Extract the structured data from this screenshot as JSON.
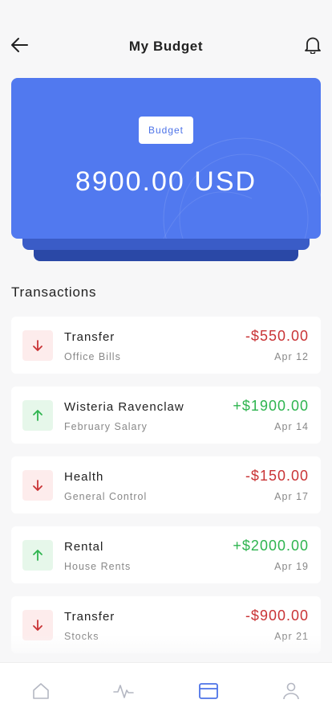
{
  "header": {
    "title": "My Budget",
    "back_icon": "arrow-left-icon",
    "notification_icon": "bell-icon"
  },
  "card": {
    "badge": "Budget",
    "amount": "8900.00 USD",
    "color": "#5179ef"
  },
  "transactions_title": "Transactions",
  "transactions": [
    {
      "name": "Transfer",
      "sub": "Office Bills",
      "amount": "-$550.00",
      "date": "Apr 12",
      "direction": "down"
    },
    {
      "name": "Wisteria Ravenclaw",
      "sub": "February Salary",
      "amount": "+$1900.00",
      "date": "Apr 14",
      "direction": "up"
    },
    {
      "name": "Health",
      "sub": "General Control",
      "amount": "-$150.00",
      "date": "Apr 17",
      "direction": "down"
    },
    {
      "name": "Rental",
      "sub": "House Rents",
      "amount": "+$2000.00",
      "date": "Apr 19",
      "direction": "up"
    },
    {
      "name": "Transfer",
      "sub": "Stocks",
      "amount": "-$900.00",
      "date": "Apr 21",
      "direction": "down"
    }
  ],
  "colors": {
    "negative": "#c93335",
    "positive": "#2eb44f",
    "active_tab": "#4d73e8"
  },
  "tabbar": {
    "items": [
      {
        "icon": "home-icon",
        "active": false
      },
      {
        "icon": "activity-icon",
        "active": false
      },
      {
        "icon": "card-icon",
        "active": true
      },
      {
        "icon": "user-icon",
        "active": false
      }
    ]
  }
}
